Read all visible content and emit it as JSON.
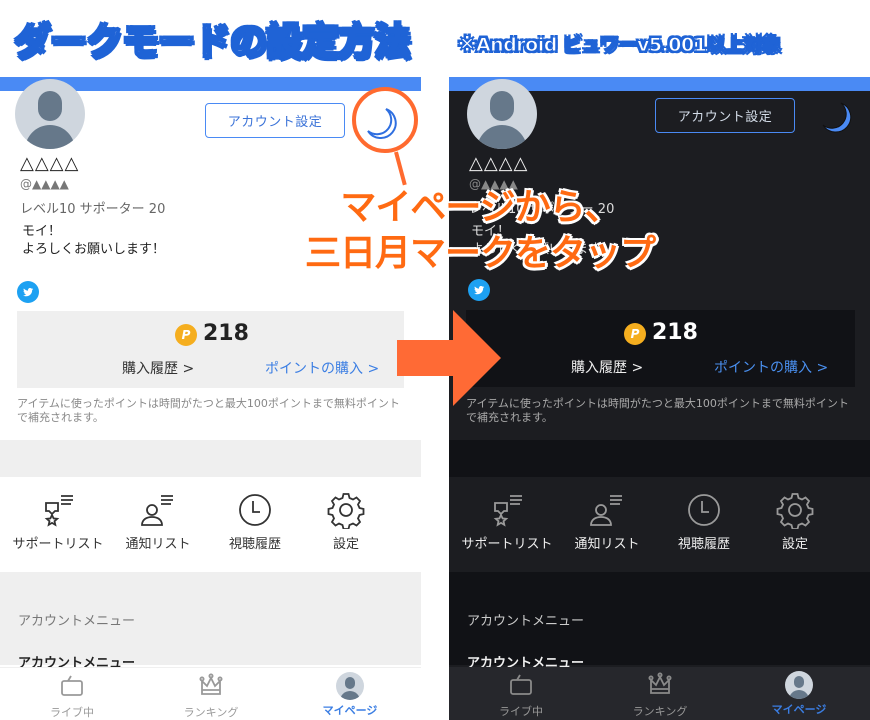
{
  "banner": {
    "title": "ダークモードの設定方法",
    "subtitle": "※Android ビュワーv5.001以上対象"
  },
  "colors": {
    "accent_blue": "#4a8af4",
    "link_blue": "#3b7ee3",
    "annotation_orange": "#ff6a2f",
    "coin_yellow": "#f5ae1f",
    "dark_bg": "#1c1d21"
  },
  "annotation": {
    "line1": "マイページから、",
    "line2": "三日月マークをタップ"
  },
  "panels": {
    "light": {
      "mode": "light",
      "account_settings_button": "アカウント設定",
      "moon_icon": "crescent-moon-outline",
      "profile": {
        "name": "△△△△",
        "handle": "@▲▲▲▲",
        "level_support": "レベル10  サポーター 20",
        "bio_line1": "モイ！",
        "bio_line2": "よろしくお願いします！"
      },
      "points": {
        "coin_letter": "P",
        "value": "218",
        "history_link": "購入履歴 >",
        "buy_link": "ポイントの購入 >",
        "note": "アイテムに使ったポイントは時間がたつと最大100ポイントまで無料ポイントで補充されます。"
      },
      "shortcuts": [
        {
          "label": "サポートリスト",
          "icon": "support-list-icon"
        },
        {
          "label": "通知リスト",
          "icon": "notify-list-icon"
        },
        {
          "label": "視聴履歴",
          "icon": "clock-icon"
        },
        {
          "label": "設定",
          "icon": "gear-icon"
        }
      ],
      "section_header": "アカウントメニュー",
      "menu_item": "アカウントメニュー",
      "tabs": [
        {
          "label": "ライブ中",
          "icon": "tv-icon",
          "active": false
        },
        {
          "label": "ランキング",
          "icon": "crown-icon",
          "active": false
        },
        {
          "label": "マイページ",
          "icon": "avatar-icon",
          "active": true
        }
      ]
    },
    "dark": {
      "mode": "dark",
      "account_settings_button": "アカウント設定",
      "moon_icon": "crescent-moon-filled",
      "profile": {
        "name": "△△△△",
        "handle": "@▲▲▲▲",
        "level_support": "レベル10  サポーター 20",
        "bio_line1": "モイ！",
        "bio_line2": "よろしくお願いします！"
      },
      "points": {
        "coin_letter": "P",
        "value": "218",
        "history_link": "購入履歴 >",
        "buy_link": "ポイントの購入 >",
        "note": "アイテムに使ったポイントは時間がたつと最大100ポイントまで無料ポイントで補充されます。"
      },
      "shortcuts": [
        {
          "label": "サポートリスト",
          "icon": "support-list-icon"
        },
        {
          "label": "通知リスト",
          "icon": "notify-list-icon"
        },
        {
          "label": "視聴履歴",
          "icon": "clock-icon"
        },
        {
          "label": "設定",
          "icon": "gear-icon"
        }
      ],
      "section_header": "アカウントメニュー",
      "menu_item": "アカウントメニュー",
      "tabs": [
        {
          "label": "ライブ中",
          "icon": "tv-icon",
          "active": false
        },
        {
          "label": "ランキング",
          "icon": "crown-icon",
          "active": false
        },
        {
          "label": "マイページ",
          "icon": "avatar-icon",
          "active": true
        }
      ]
    }
  }
}
